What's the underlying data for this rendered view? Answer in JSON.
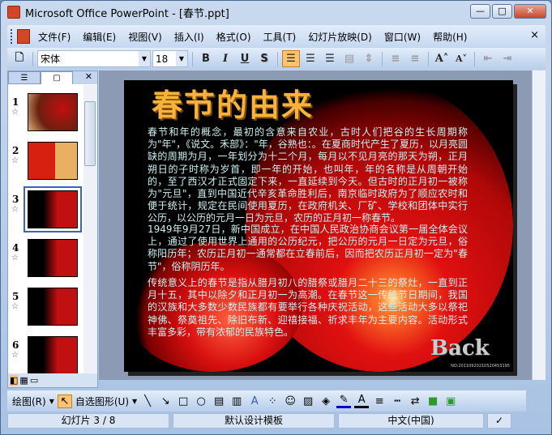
{
  "window": {
    "title": "Microsoft Office PowerPoint - [春节.ppt]",
    "min": "—",
    "max": "□",
    "close": "✕"
  },
  "menu": [
    "文件(F)",
    "编辑(E)",
    "视图(V)",
    "插入(I)",
    "格式(O)",
    "工具(T)",
    "幻灯片放映(D)",
    "窗口(W)",
    "帮助(H)"
  ],
  "menu_close": "×",
  "format": {
    "font": "宋体",
    "size": "18",
    "bold": "B",
    "italic": "I",
    "underline": "U",
    "shadow": "S"
  },
  "panel": {
    "tab_outline": "☰",
    "tab_slides": "▢",
    "close": "✕",
    "slides": [
      {
        "num": "1"
      },
      {
        "num": "2"
      },
      {
        "num": "3"
      },
      {
        "num": "4"
      },
      {
        "num": "5"
      },
      {
        "num": "6"
      }
    ],
    "star": "☆"
  },
  "slide": {
    "title": "春节的由来",
    "p1": "春节和年的概念，最初的含意来自农业，古时人们把谷的生长周期称为\"年\"，《说文。禾部》：\"年，谷熟也：。在夏商时代产生了夏历，以月亮圆缺的周期为月，一年划分为十二个月，每月以不见月亮的那天为朔，正月朔日的子时称为岁首，即一年的开始，也叫年，年的名称是从周朝开始的，至了西汉才正式固定下来，一直延续到今天。但古时的正月初一被称为\"元旦\"，直到中国近代辛亥革命胜利后，南京临时政府为了顺应农时和便于统计，规定在民间使用夏历，在政府机关、厂矿、学校和团体中实行公历，以公历的元月一日为元旦，农历的正月初一称春节。",
    "p2": "1949年9月27日，新中国成立，在中国人民政治协商会议第一届全体会议上，通过了使用世界上通用的公历纪元，把公历的元月一日定为元旦，俗称阳历年；农历正月初一通常都在立春前后，因而把农历正月初一定为\"春节\"，俗称阴历年。",
    "p3": "传统意义上的春节是指从腊月初八的腊祭或腊月二十三的祭灶，一直到正月十五，其中以除夕和正月初一为高潮。在春节这一传统节日期间，我国的汉族和大多数少数民族都有要举行各种庆祝活动，这些活动大多以祭祀神佛、祭奠祖先、除旧布新、迎禧接福、祈求丰年为主要内容。活动形式丰富多彩，带有浓郁的民族特色。",
    "back": "Back",
    "no": "NO:20110920210520453195"
  },
  "drawing": {
    "draw": "绘图(R)",
    "autoshapes": "自选图形(U)"
  },
  "status": {
    "slide": "幻灯片 3 / 8",
    "template": "默认设计模板",
    "language": "中文(中国)"
  }
}
